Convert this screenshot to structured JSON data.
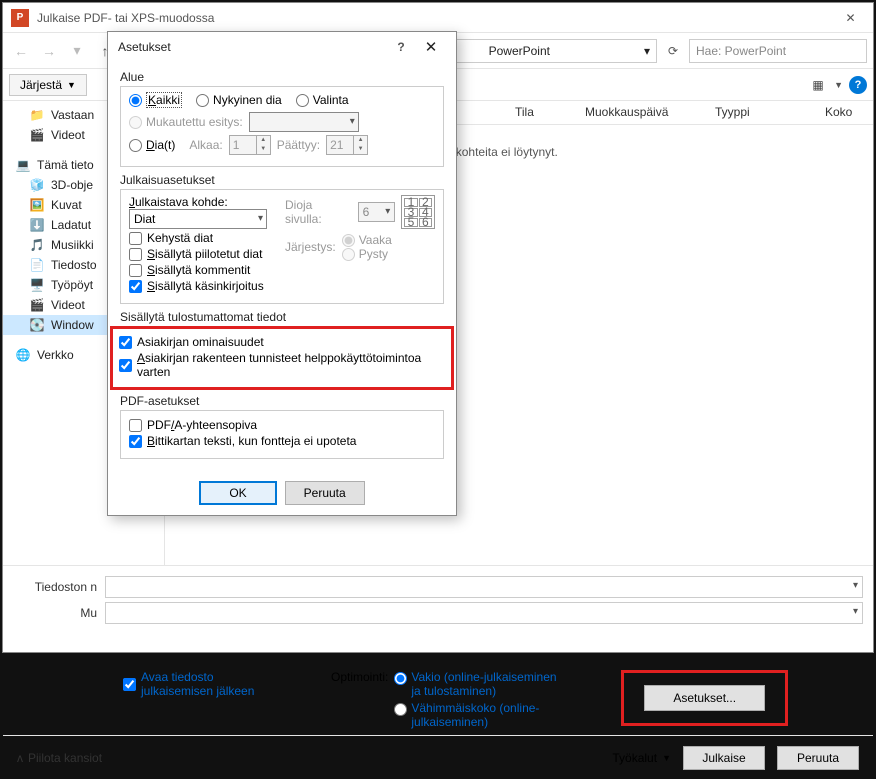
{
  "window": {
    "title": "Julkaise PDF- tai XPS-muodossa"
  },
  "breadcrumb": {
    "final": "PowerPoint"
  },
  "search": {
    "placeholder": "Hae: PowerPoint"
  },
  "toolbar": {
    "organize": "Järjestä"
  },
  "sidebar": {
    "items": [
      {
        "label": "Vastaan"
      },
      {
        "label": "Videot"
      },
      {
        "label": "Tämä tieto"
      },
      {
        "label": "3D-obje"
      },
      {
        "label": "Kuvat"
      },
      {
        "label": "Ladatut"
      },
      {
        "label": "Musiikki"
      },
      {
        "label": "Tiedosto"
      },
      {
        "label": "Työpöyt"
      },
      {
        "label": "Videot"
      },
      {
        "label": "Window"
      },
      {
        "label": "Verkko"
      }
    ]
  },
  "columns": {
    "state": "Tila",
    "modified": "Muokkauspäivä",
    "type": "Tyyppi",
    "size": "Koko"
  },
  "content": {
    "empty": "uehtoja täyttäviä kohteita ei löytynyt."
  },
  "bottom": {
    "filename_label": "Tiedoston n",
    "type_label": "Mu",
    "open_after": "Avaa tiedosto julkaisemisen jälkeen",
    "optimize_label": "Optimointi:",
    "opt_standard": "Vakio (online-julkaiseminen ja tulostaminen)",
    "opt_min": "Vähimmäiskoko (online-julkaiseminen)",
    "settings_btn": "Asetukset..."
  },
  "footer": {
    "hide_folders": "Piilota kansiot",
    "tools": "Työkalut",
    "publish": "Julkaise",
    "cancel": "Peruuta"
  },
  "dialog": {
    "title": "Asetukset",
    "range": {
      "label": "Alue",
      "all": "Kaikki",
      "current": "Nykyinen dia",
      "selection": "Valinta",
      "custom": "Mukautettu esitys:",
      "slides": "Dia(t)",
      "from": "Alkaa:",
      "from_val": "1",
      "to": "Päättyy:",
      "to_val": "21"
    },
    "publish": {
      "label": "Julkaisuasetukset",
      "what_label": "Julkaistava kohde:",
      "what_value": "Diat",
      "per_page": "Dioja sivulla:",
      "per_page_val": "6",
      "order": "Järjestys:",
      "horiz": "Vaaka",
      "vert": "Pysty",
      "frame": "Kehystä diat",
      "hidden": "Sisällytä piilotetut diat",
      "comments": "Sisällytä kommentit",
      "ink": "Sisällytä käsinkirjoitus"
    },
    "nonprint": {
      "label": "Sisällytä tulostumattomat tiedot",
      "props": "Asiakirjan ominaisuudet",
      "tags": "Asiakirjan rakenteen tunnisteet helppokäyttötoimintoa varten"
    },
    "pdf": {
      "label": "PDF-asetukset",
      "pdfa": "PDF/A-yhteensopiva",
      "bitmap": "Bittikartan teksti, kun fontteja ei upoteta"
    },
    "ok": "OK",
    "cancel": "Peruuta"
  }
}
